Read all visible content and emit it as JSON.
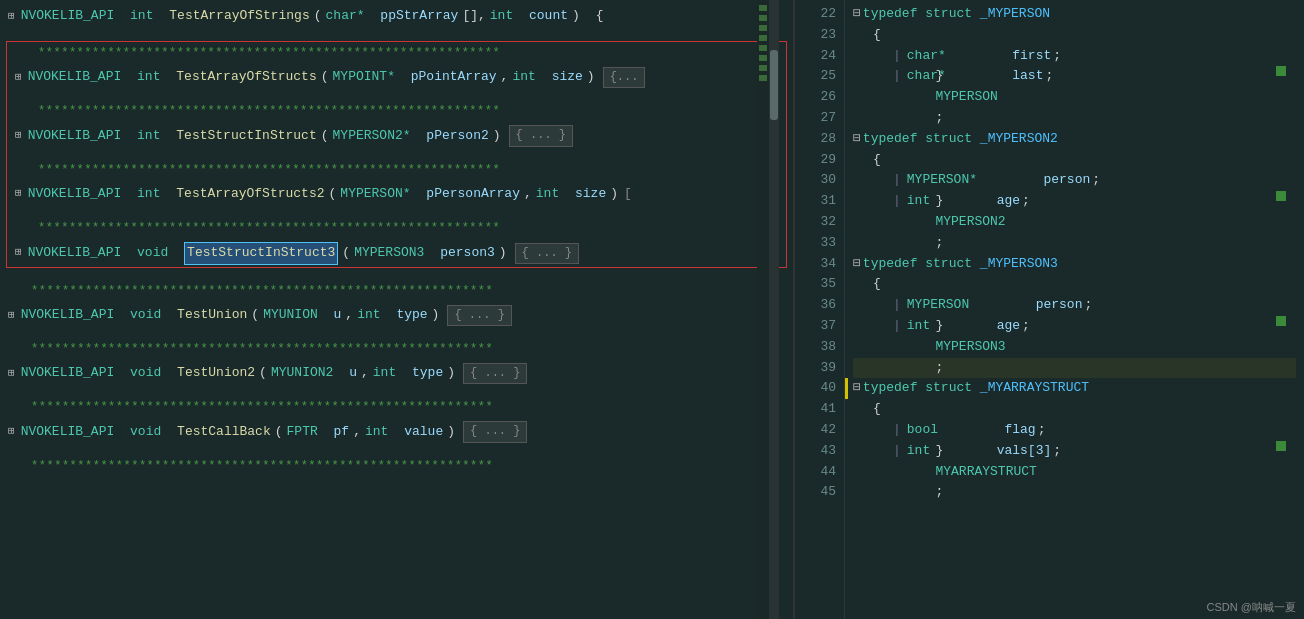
{
  "left": {
    "lines": [
      {
        "type": "function",
        "expand": true,
        "api": "NVOKELIB_API",
        "ret": "int",
        "name": "TestArrayOfStrings",
        "params": "char* ppStrArray[], int count",
        "body": null,
        "border": "top-brace"
      },
      {
        "type": "empty"
      },
      {
        "type": "comment",
        "text": "************************************************************"
      },
      {
        "type": "function",
        "expand": true,
        "api": "NVOKELIB_API",
        "ret": "int",
        "name": "TestArrayOfStructs",
        "params": "MYPOINT* pPointArray, int size",
        "body": "{...}",
        "selected": true
      },
      {
        "type": "empty"
      },
      {
        "type": "comment",
        "text": "************************************************************"
      },
      {
        "type": "function",
        "expand": true,
        "api": "NVOKELIB_API",
        "ret": "int",
        "name": "TestStructInStruct",
        "params": "MYPERSON2* pPerson2",
        "body": "{ ... }",
        "selected": true
      },
      {
        "type": "empty"
      },
      {
        "type": "comment",
        "text": "************************************************************"
      },
      {
        "type": "function",
        "expand": true,
        "api": "NVOKELIB_API",
        "ret": "int",
        "name": "TestArrayOfStructs2",
        "params": "MYPERSON* pPersonArray, int size",
        "body": null,
        "selected": true
      },
      {
        "type": "empty"
      },
      {
        "type": "comment",
        "text": "************************************************************"
      },
      {
        "type": "function",
        "expand": true,
        "api": "NVOKELIB_API",
        "ret": "void",
        "name": "TestStructInStruct3",
        "params": "MYPERSON3 person3",
        "body": "{ ... }",
        "highlight": true,
        "selected": true
      },
      {
        "type": "empty"
      },
      {
        "type": "comment",
        "text": "************************************************************"
      },
      {
        "type": "function",
        "expand": true,
        "api": "NVOKELIB_API",
        "ret": "void",
        "name": "TestUnion",
        "params": "MYUNION u, int type",
        "body": "{ ... }"
      },
      {
        "type": "empty"
      },
      {
        "type": "comment",
        "text": "************************************************************"
      },
      {
        "type": "function",
        "expand": true,
        "api": "NVOKELIB_API",
        "ret": "void",
        "name": "TestUnion2",
        "params": "MYUNION2 u, int type",
        "body": "{ ... }"
      },
      {
        "type": "empty"
      },
      {
        "type": "comment",
        "text": "************************************************************"
      },
      {
        "type": "function",
        "expand": true,
        "api": "NVOKELIB_API",
        "ret": "void",
        "name": "TestCallBack",
        "params": "FPTR pf, int value",
        "body": "{ ... }"
      },
      {
        "type": "empty"
      },
      {
        "type": "comment",
        "text": "************************************************************"
      }
    ]
  },
  "right": {
    "startLine": 22,
    "lines": [
      {
        "num": 22,
        "content": "typedef struct _MYPERSON",
        "indent": 0,
        "collapse": true
      },
      {
        "num": 23,
        "content": "{",
        "indent": 1
      },
      {
        "num": 24,
        "content": "char* first;",
        "indent": 2
      },
      {
        "num": 25,
        "content": "char* last;",
        "indent": 2
      },
      {
        "num": 26,
        "content": "} MYPERSON;",
        "indent": 1
      },
      {
        "num": 27,
        "content": "",
        "indent": 0
      },
      {
        "num": 28,
        "content": "typedef struct _MYPERSON2",
        "indent": 0,
        "collapse": true
      },
      {
        "num": 29,
        "content": "{",
        "indent": 1
      },
      {
        "num": 30,
        "content": "MYPERSON* person;",
        "indent": 2
      },
      {
        "num": 31,
        "content": "int age;",
        "indent": 2
      },
      {
        "num": 32,
        "content": "} MYPERSON2;",
        "indent": 1
      },
      {
        "num": 33,
        "content": "",
        "indent": 0
      },
      {
        "num": 34,
        "content": "typedef struct _MYPERSON3",
        "indent": 0,
        "collapse": true
      },
      {
        "num": 35,
        "content": "{",
        "indent": 1
      },
      {
        "num": 36,
        "content": "MYPERSON person;",
        "indent": 2
      },
      {
        "num": 37,
        "content": "int age;",
        "indent": 2
      },
      {
        "num": 38,
        "content": "} MYPERSON3;",
        "indent": 1
      },
      {
        "num": 39,
        "content": "",
        "indent": 0
      },
      {
        "num": 40,
        "content": "typedef struct _MYARRAYSTRUCT",
        "indent": 0,
        "collapse": true
      },
      {
        "num": 41,
        "content": "{",
        "indent": 1
      },
      {
        "num": 42,
        "content": "bool flag;",
        "indent": 2
      },
      {
        "num": 43,
        "content": "int vals[3];",
        "indent": 2
      },
      {
        "num": 44,
        "content": "} MYARRAYSTRUCT;",
        "indent": 1
      },
      {
        "num": 45,
        "content": "",
        "indent": 0
      }
    ]
  },
  "watermark": "CSDN @呐喊一夏"
}
